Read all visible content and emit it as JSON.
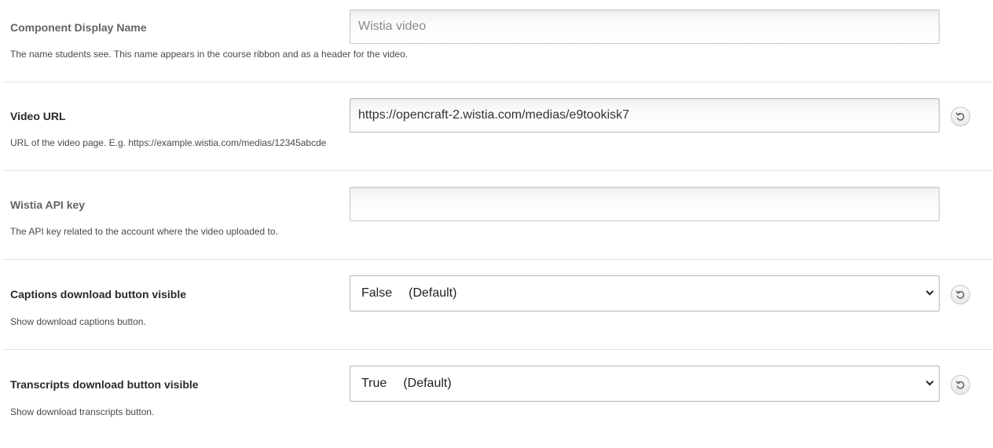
{
  "settings": [
    {
      "label": "Component Display Name",
      "value": "",
      "placeholder": "Wistia video",
      "help": "The name students see. This name appears in the course ribbon and as a header for the video."
    },
    {
      "label": "Video URL",
      "value": "https://opencraft-2.wistia.com/medias/e9tookisk7",
      "help": "URL of the video page. E.g. https://example.wistia.com/medias/12345abcde",
      "reset_icon": "reset-icon"
    },
    {
      "label": "Wistia API key",
      "value": "",
      "placeholder": "",
      "help": "The API key related to the account where the video uploaded to."
    },
    {
      "label": "Captions download button visible",
      "selected_value": "False",
      "selected_note": "(Default)",
      "help": "Show download captions button.",
      "reset_icon": "reset-icon"
    },
    {
      "label": "Transcripts download button visible",
      "selected_value": "True",
      "selected_note": "(Default)",
      "help": "Show download transcripts button.",
      "reset_icon": "reset-icon"
    }
  ]
}
